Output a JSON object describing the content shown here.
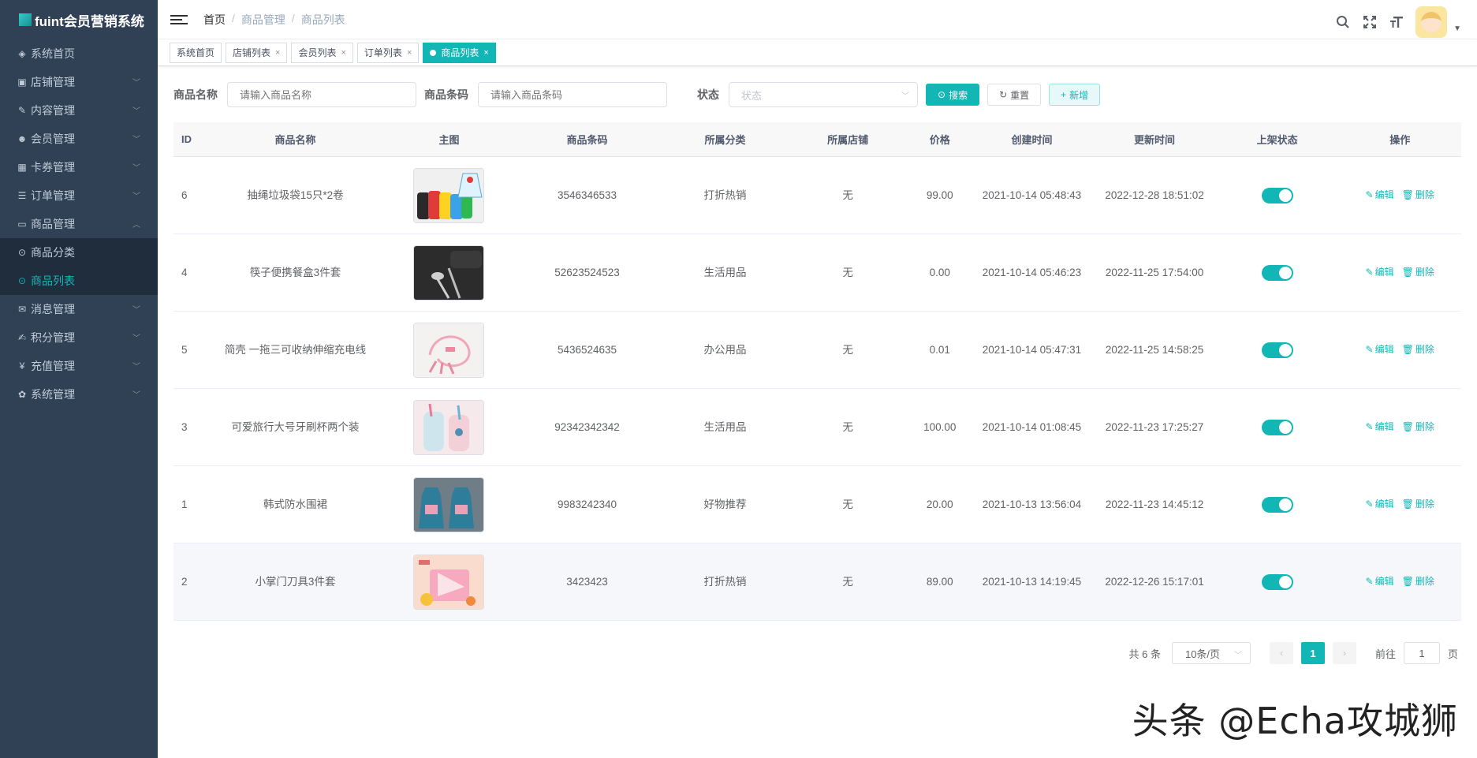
{
  "app": {
    "title": "fuint会员营销系统"
  },
  "sidebar": {
    "items": [
      {
        "label": "系统首页",
        "icon": "dashboard-icon",
        "glyph": "◈",
        "expandable": false
      },
      {
        "label": "店铺管理",
        "icon": "shopping-cart-icon",
        "glyph": "▣",
        "expandable": true
      },
      {
        "label": "内容管理",
        "icon": "edit-icon",
        "glyph": "✎",
        "expandable": true
      },
      {
        "label": "会员管理",
        "icon": "users-icon",
        "glyph": "☻",
        "expandable": true
      },
      {
        "label": "卡券管理",
        "icon": "coupon-icon",
        "glyph": "▦",
        "expandable": true
      },
      {
        "label": "订单管理",
        "icon": "list-icon",
        "glyph": "☰",
        "expandable": true
      },
      {
        "label": "商品管理",
        "icon": "monitor-icon",
        "glyph": "▭",
        "expandable": true,
        "open": true
      },
      {
        "label": "消息管理",
        "icon": "message-icon",
        "glyph": "✉",
        "expandable": true
      },
      {
        "label": "积分管理",
        "icon": "points-icon",
        "glyph": "✍",
        "expandable": true
      },
      {
        "label": "充值管理",
        "icon": "yen-icon",
        "glyph": "¥",
        "expandable": true
      },
      {
        "label": "系统管理",
        "icon": "settings-icon",
        "glyph": "✿",
        "expandable": true
      }
    ],
    "sub_items": [
      {
        "label": "商品分类",
        "active": false
      },
      {
        "label": "商品列表",
        "active": true
      }
    ]
  },
  "navbar": {
    "breadcrumb": [
      "首页",
      "商品管理",
      "商品列表"
    ],
    "separator": "/"
  },
  "tags": [
    {
      "label": "系统首页",
      "closable": false,
      "active": false
    },
    {
      "label": "店铺列表",
      "closable": true,
      "active": false
    },
    {
      "label": "会员列表",
      "closable": true,
      "active": false
    },
    {
      "label": "订单列表",
      "closable": true,
      "active": false
    },
    {
      "label": "商品列表",
      "closable": true,
      "active": true
    }
  ],
  "filters": {
    "name_label": "商品名称",
    "name_placeholder": "请输入商品名称",
    "code_label": "商品条码",
    "code_placeholder": "请输入商品条码",
    "status_label": "状态",
    "status_placeholder": "状态",
    "search_btn": "搜索",
    "reset_btn": "重置",
    "add_btn": "新增"
  },
  "table": {
    "headers": [
      "ID",
      "商品名称",
      "主图",
      "商品条码",
      "所属分类",
      "所属店铺",
      "价格",
      "创建时间",
      "更新时间",
      "上架状态",
      "操作"
    ],
    "edit_label": "编辑",
    "delete_label": "删除",
    "rows": [
      {
        "id": "6",
        "name": "抽绳垃圾袋15只*2卷",
        "image": "garbage-bag-photo",
        "code": "3546346533",
        "category": "打折热销",
        "shop": "无",
        "price": "99.00",
        "created": "2021-10-14 05:48:43",
        "updated": "2022-12-28 18:51:02",
        "on_sale": true,
        "highlight": false
      },
      {
        "id": "4",
        "name": "筷子便携餐盒3件套",
        "image": "cutlery-set-photo",
        "code": "52623524523",
        "category": "生活用品",
        "shop": "无",
        "price": "0.00",
        "created": "2021-10-14 05:46:23",
        "updated": "2022-11-25 17:54:00",
        "on_sale": true,
        "highlight": false
      },
      {
        "id": "5",
        "name": "简壳 一拖三可收纳伸缩充电线",
        "image": "charging-cable-photo",
        "code": "5436524635",
        "category": "办公用品",
        "shop": "无",
        "price": "0.01",
        "created": "2021-10-14 05:47:31",
        "updated": "2022-11-25 14:58:25",
        "on_sale": true,
        "highlight": false
      },
      {
        "id": "3",
        "name": "可爱旅行大号牙刷杯两个装",
        "image": "toothbrush-cup-photo",
        "code": "92342342342",
        "category": "生活用品",
        "shop": "无",
        "price": "100.00",
        "created": "2021-10-14 01:08:45",
        "updated": "2022-11-23 17:25:27",
        "on_sale": true,
        "highlight": false
      },
      {
        "id": "1",
        "name": "韩式防水围裙",
        "image": "apron-photo",
        "code": "9983242340",
        "category": "好物推荐",
        "shop": "无",
        "price": "20.00",
        "created": "2021-10-13 13:56:04",
        "updated": "2022-11-23 14:45:12",
        "on_sale": true,
        "highlight": false
      },
      {
        "id": "2",
        "name": "小掌门刀具3件套",
        "image": "knife-set-photo",
        "code": "3423423",
        "category": "打折热销",
        "shop": "无",
        "price": "89.00",
        "created": "2021-10-13 14:19:45",
        "updated": "2022-12-26 15:17:01",
        "on_sale": true,
        "highlight": true
      }
    ]
  },
  "pagination": {
    "total_text": "共 6 条",
    "page_size": "10条/页",
    "current_page": "1",
    "goto_label": "前往",
    "goto_value": "1",
    "page_suffix": "页"
  },
  "watermark": "头条 @Echa攻城狮",
  "colors": {
    "sidebar_bg": "#304156",
    "accent": "#12b7b5",
    "submenu_bg": "#1f2d3d"
  }
}
